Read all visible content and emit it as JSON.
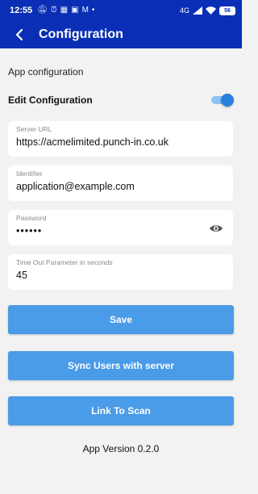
{
  "status_bar": {
    "time": "12:55",
    "network": "4G",
    "battery": "56"
  },
  "app_bar": {
    "title": "Configuration"
  },
  "section_title": "App configuration",
  "edit_configuration": {
    "label": "Edit Configuration",
    "enabled": true
  },
  "fields": {
    "server_url": {
      "label": "Server URL",
      "value": "https://acmelimited.punch-in.co.uk"
    },
    "identifier": {
      "label": "Identifier",
      "value": "application@example.com"
    },
    "password": {
      "label": "Password",
      "value": "••••••"
    },
    "timeout": {
      "label": "Time Out Parameter in seconds",
      "value": "45"
    }
  },
  "buttons": {
    "save": "Save",
    "sync": "Sync Users with server",
    "link": "Link To Scan"
  },
  "version": "App Version 0.2.0",
  "colors": {
    "primary_bar": "#0a2fb6",
    "button": "#4a9be8",
    "toggle_on": "#2a7fe0"
  }
}
